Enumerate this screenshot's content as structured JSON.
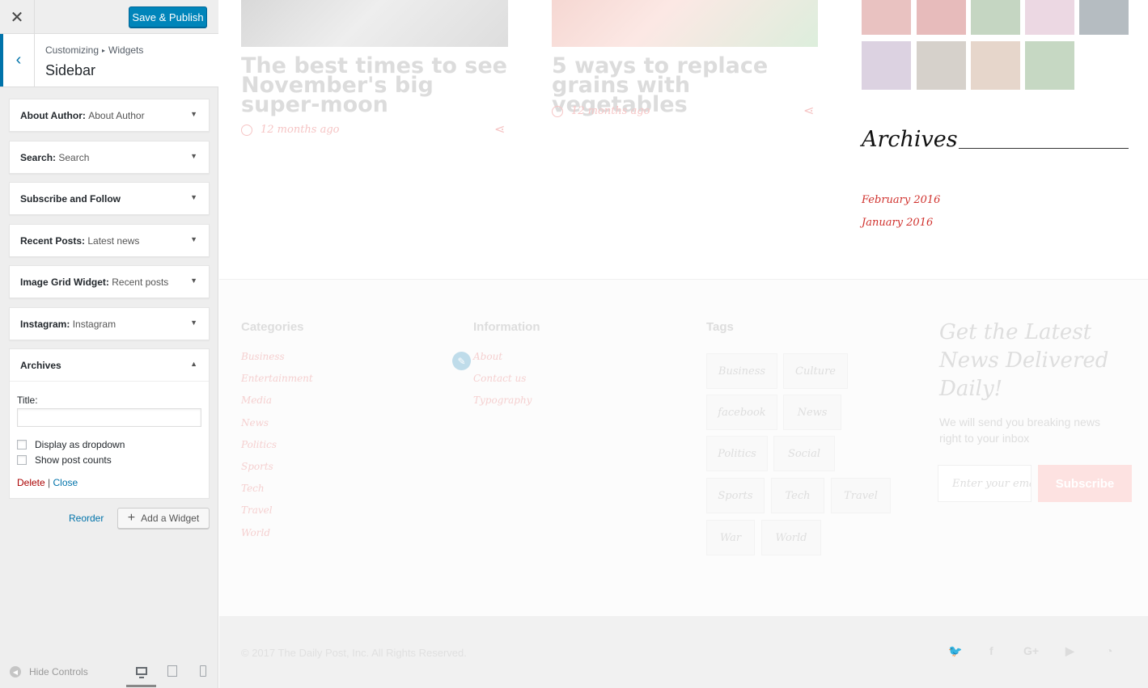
{
  "topbar": {
    "close_icon": "✕",
    "publish_label": "Save & Publish"
  },
  "section": {
    "breadcrumb_root": "Customizing",
    "breadcrumb_sep": "▸",
    "breadcrumb_current": "Widgets",
    "title": "Sidebar",
    "back_icon": "‹"
  },
  "widgets": [
    {
      "name": "About Author",
      "sub": "About Author"
    },
    {
      "name": "Search",
      "sub": "Search"
    },
    {
      "name": "Subscribe and Follow",
      "sub": ""
    },
    {
      "name": "Recent Posts",
      "sub": "Latest news"
    },
    {
      "name": "Image Grid Widget",
      "sub": "Recent posts"
    },
    {
      "name": "Instagram",
      "sub": "Instagram"
    }
  ],
  "archives_widget": {
    "name": "Archives",
    "title_label": "Title:",
    "title_value": "",
    "opt_dropdown": "Display as dropdown",
    "opt_counts": "Show post counts",
    "delete_label": "Delete",
    "sep": "|",
    "close_label": "Close"
  },
  "actions": {
    "reorder": "Reorder",
    "add_widget": "Add a Widget",
    "add_icon": "+"
  },
  "footer_controls": {
    "hide_controls": "Hide Controls",
    "hide_icon": "◀"
  },
  "preview": {
    "post1": {
      "title": "The best times to see November's big super-moon",
      "meta": "12 months ago"
    },
    "post2": {
      "title": "5 ways to replace grains with vegetables",
      "meta": "12 months ago"
    },
    "share_icon": "⋖",
    "archives_heading": "Archives",
    "archive_links": [
      "February 2016",
      "January 2016"
    ],
    "categories_head": "Categories",
    "categories": [
      "Business",
      "Entertainment",
      "Media",
      "News",
      "Politics",
      "Sports",
      "Tech",
      "Travel",
      "World"
    ],
    "information_head": "Information",
    "information": [
      "About",
      "Contact us",
      "Typography"
    ],
    "tags_head": "Tags",
    "tags": [
      "Business",
      "Culture",
      "facebook",
      "News",
      "Politics",
      "Social",
      "Sports",
      "Tech",
      "Travel",
      "War",
      "World"
    ],
    "newsletter_head": "Get the Latest News Delivered Daily!",
    "newsletter_text": "We will send you breaking news right to your inbox",
    "newsletter_placeholder": "Enter your email",
    "subscribe_label": "Subscribe",
    "copyright": "© 2017 The Daily Post, Inc. All Rights Reserved.",
    "edit_icon": "✎",
    "social_icons": [
      "twitter-icon",
      "facebook-icon",
      "google-plus-icon",
      "youtube-icon",
      "rss-icon"
    ],
    "social_glyphs": [
      "🐦",
      "f",
      "G+",
      "▶",
      "◔"
    ]
  },
  "colors": {
    "accent": "#0085ba",
    "link": "#0073aa",
    "danger": "#a00",
    "archive_link": "#d0312d"
  }
}
